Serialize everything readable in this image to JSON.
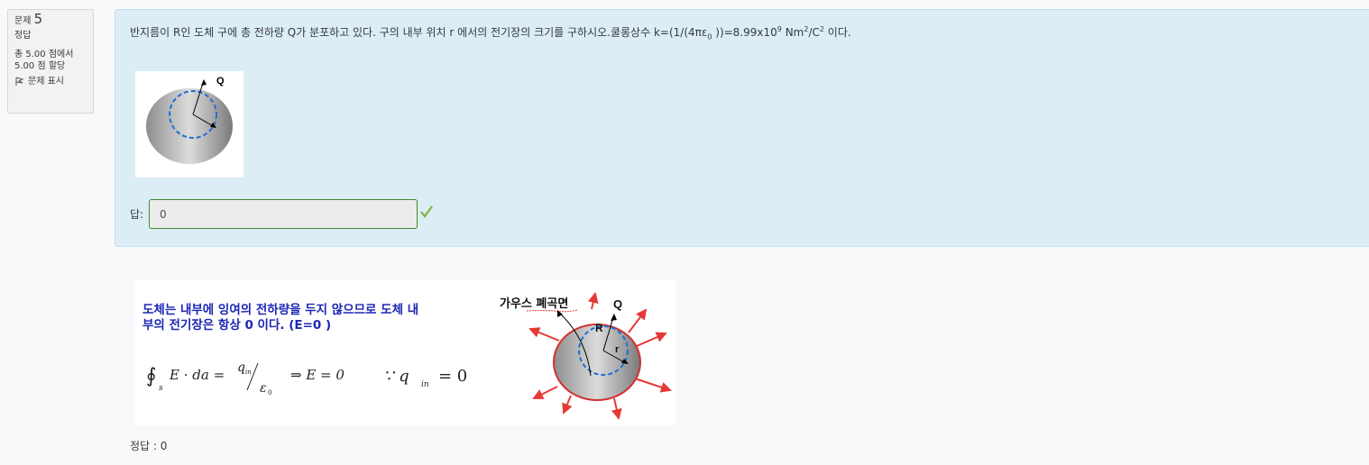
{
  "info": {
    "qno_prefix": "문제",
    "qno_number": "5",
    "state": "정답",
    "grade_line1": "총 5.00 점에서",
    "grade_line2": "5.00 점 할당",
    "flag_label": "문제 표시"
  },
  "question": {
    "text_main": "반지름이 R인 도체 구에 총 전하량 Q가 분포하고 있다. 구의 내부 위치 r 에서의  전기장의 크기를 구하시오.쿨롱상수  k=(1/(4πε",
    "text_sub0": "0",
    "text_mid": " ))=8.99x10",
    "text_sup9": "9",
    "text_unit": " Nm",
    "text_sup2a": "2",
    "text_unit2": "/C",
    "text_sup2b": "2",
    "text_end": " 이다.",
    "figure_label": "Q"
  },
  "answer": {
    "label": "답:",
    "value": "0"
  },
  "feedback": {
    "line1": "도체는 내부에 잉여의 전하량을 두지 않으므로 도체 내",
    "line2": "부의 전기장은 항상 0 이다.   (E=0 )",
    "gauss_label": "가우스 폐곡면",
    "label_Q": "Q",
    "label_R": "R",
    "label_r": "r",
    "formula_lhs": "∮",
    "formula_s": "s",
    "formula_E": "E · da =",
    "formula_qin": "q",
    "formula_in": "in",
    "formula_eps": "ε",
    "formula_zero": "0",
    "formula_implies": "⇒  E = 0",
    "formula_because": "∵  q",
    "formula_in2": "in",
    "formula_eq0": "= 0"
  },
  "right_answer": "정답 : 0"
}
